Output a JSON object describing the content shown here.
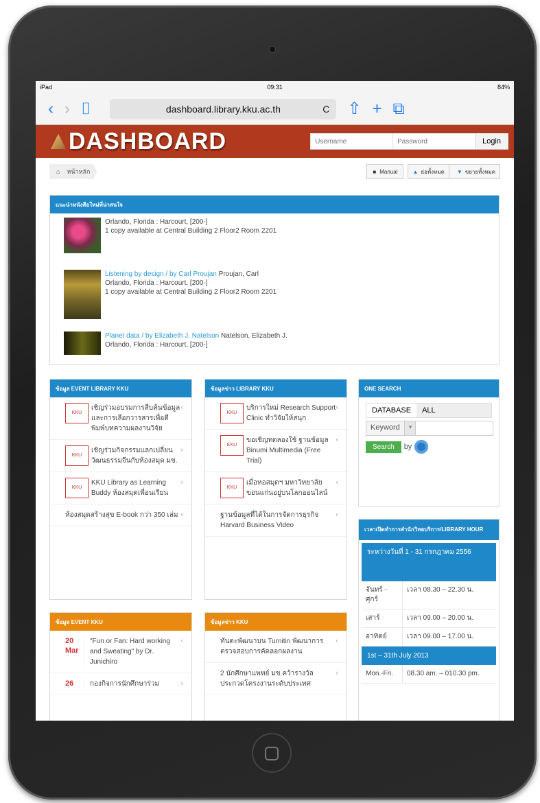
{
  "status": {
    "device": "iPad",
    "time": "09:31",
    "battery": "84%"
  },
  "browser": {
    "url": "dashboard.library.kku.ac.th",
    "back": "‹",
    "forward": "›",
    "bookmarks": "⌷",
    "reload": "C",
    "share": "⇧",
    "add": "+",
    "tabs": "⧉"
  },
  "header": {
    "logo": "DASHBOARD",
    "username_ph": "Username",
    "password_ph": "Password",
    "login": "Login"
  },
  "breadcrumb": {
    "home": "⌂",
    "current": "หน้าหลัก"
  },
  "toolbar": {
    "manual": "Manual",
    "expand": "ย่อทั้งหมด",
    "collapse": "ขยายทั้งหมด"
  },
  "newbooks": {
    "title": "แนะนำหนังสือใหม่ที่น่าสนใจ",
    "items": [
      {
        "title": "",
        "author": "",
        "line1": "Orlando, Florida : Harcourt, [200-]",
        "line2": "1 copy available at Central Building 2 Floor2 Room 2201"
      },
      {
        "title": "Listening by design / by Carl Proujan",
        "author": "Proujan, Carl",
        "line1": "Orlando, Florida : Harcourt, [200-]",
        "line2": "1 copy available at Central Building 2 Floor2 Room 2201"
      },
      {
        "title": "Planet data / by Elizabeth J. Natelson",
        "author": "Natelson, Elizabeth J.",
        "line1": "Orlando, Florida : Harcourt, [200-]",
        "line2": ""
      }
    ]
  },
  "event_library": {
    "title": "ข้อมูล EVENT LIBRARY KKU",
    "items": [
      "เชิญร่วมอบรมการสืบค้นข้อมูลและการเลือกวารสารเพื่อตีพิมพ์บทความผลงานวิจัย",
      "เชิญร่วมกิจกรรมแลกเปลี่ยนวัฒนธรรมจีนกับห้องสมุด มข.",
      "KKU Library as Learning Buddy ห้องสมุดเพื่อนเรียน",
      "ห้องสมุดสร้างสุข E-book กว่า 350 เล่ม"
    ]
  },
  "news_library": {
    "title": "ข้อมูลข่าว LIBRARY KKU",
    "items": [
      "บริการใหม่ Research Support Clinic ทำวิจัยให้สนุก",
      "ขอเชิญทดลองใช้ ฐานข้อมูล Binumi Multimedia (Free Trial)",
      "เมื่อหอสมุดฯ มหาวิทยาลัยขอนแก่นอยู่บนโลกออนไลน์",
      "ฐานข้อมูลที่ได้ในการจัดการธุรกิจ Harvard Business Video"
    ]
  },
  "one_search": {
    "title": "ONE SEARCH",
    "db_label": "DATABASE",
    "db_value": "ALL",
    "keyword": "Keyword",
    "search": "Search",
    "by": "by"
  },
  "hours": {
    "title": "เวลาเปิดทำการสำนักวิทยบริการ/LIBRARY HOUR",
    "period1": "ระหว่างวันที่ 1 - 31 กรกฎาคม 2556",
    "rows": [
      {
        "d": "จันทร์ - ศุกร์",
        "t": "เวลา 08.30 – 22.30 น."
      },
      {
        "d": "เสาร์",
        "t": "เวลา 09.00 – 20.00 น."
      },
      {
        "d": "อาทิตย์",
        "t": "เวลา 09.00 – 17.00 น."
      }
    ],
    "period2": "1st – 31th July 2013",
    "row_en": {
      "d": "Mon.-Fri.",
      "t": "08.30 am. – 010.30 pm."
    }
  },
  "event_kku": {
    "title": "ข้อมูล EVENT KKU",
    "items": [
      {
        "day": "20",
        "mon": "Mar",
        "text": "\"Fun or Fan: Hard working and Sweating\" by Dr. Junichiro"
      },
      {
        "day": "26",
        "mon": "",
        "text": "กองกิจการนักศึกษาร่วม"
      }
    ]
  },
  "news_kku": {
    "title": "ข้อมูลข่าว KKU",
    "items": [
      "ทันตะพัฒนาบน Turnitin พัฒนาการตรวจสอบการคัดลอกผลงาน",
      "2 นักศึกษาแพทย์ มข.คว้ารางวัลประกวดโครงงานระดับประเทศ"
    ]
  }
}
